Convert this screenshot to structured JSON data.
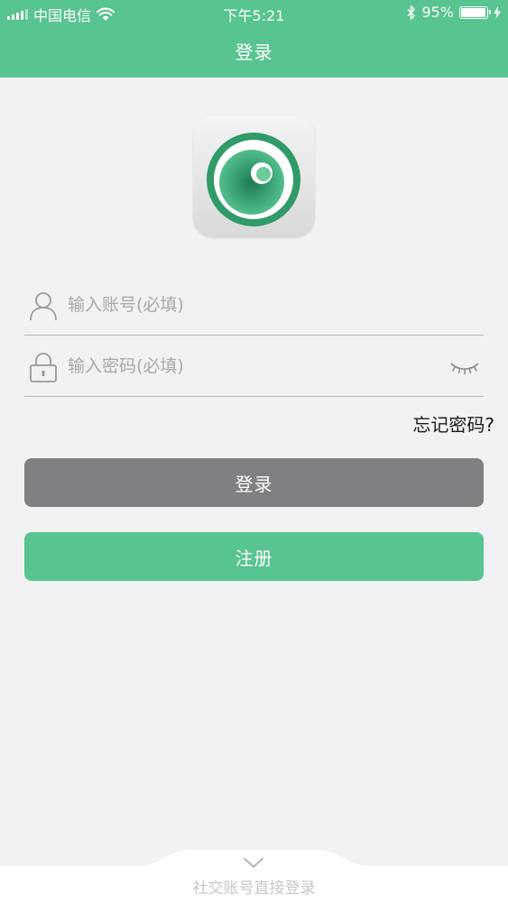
{
  "status_bar": {
    "carrier": "中国电信",
    "time": "下午5:21",
    "battery": "95%",
    "battery_level": 0.95
  },
  "nav": {
    "title": "登录"
  },
  "login_form": {
    "account_placeholder": "输入账号(必填)",
    "password_placeholder": "输入密码(必填)",
    "forgot_password": "忘记密码?"
  },
  "buttons": {
    "login": "登录",
    "register": "注册"
  },
  "social_login": {
    "label": "社交账号直接登录"
  },
  "colors": {
    "brand_green": "#58c48f",
    "login_button_gray": "#807f84",
    "background": "#f2f2f4"
  },
  "icons": [
    "signal-icon",
    "wifi-icon",
    "bluetooth-icon",
    "battery-icon",
    "charging-icon",
    "user-icon",
    "lock-icon",
    "eye-closed-icon",
    "chevron-down-icon",
    "app-logo-icon"
  ]
}
